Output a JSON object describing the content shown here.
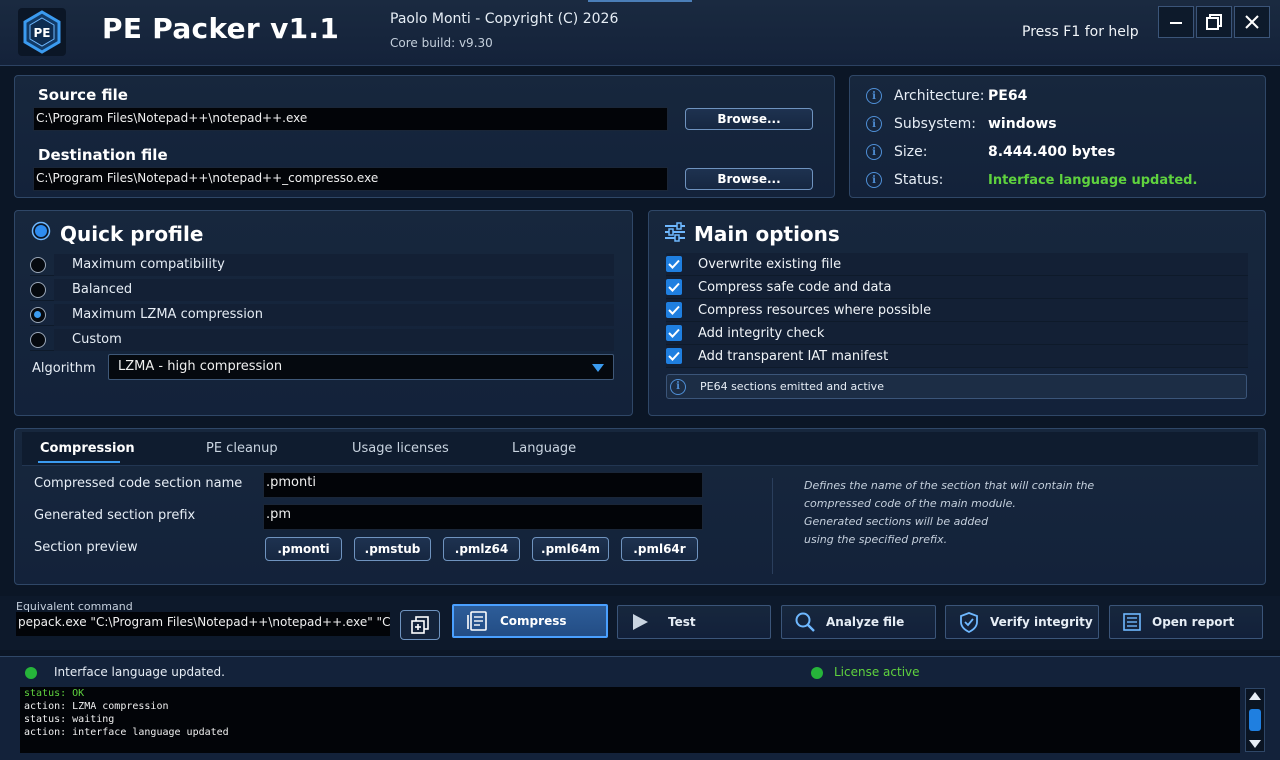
{
  "app": {
    "logo_text": "PE",
    "title": "PE Packer v1.1",
    "copyright": "Paolo Monti - Copyright (C) 2026",
    "core_build": "Core build: v9.30",
    "help": "Press F1 for help"
  },
  "files": {
    "source_label": "Source file",
    "source_path": "C:\\Program Files\\Notepad++\\notepad++.exe",
    "destination_label": "Destination file",
    "destination_path": "C:\\Program Files\\Notepad++\\notepad++_compresso.exe",
    "browse_label": "Browse..."
  },
  "info": [
    {
      "key": "Architecture:",
      "value": "PE64",
      "color": "#ffffff"
    },
    {
      "key": "Subsystem:",
      "value": "windows",
      "color": "#ffffff"
    },
    {
      "key": "Size:",
      "value": "8.444.400 bytes",
      "color": "#ffffff"
    },
    {
      "key": "Status:",
      "value": "Interface language updated.",
      "color": "#5fd23e"
    }
  ],
  "quick_profile": {
    "title": "Quick profile",
    "options": [
      {
        "label": "Maximum compatibility",
        "selected": false
      },
      {
        "label": "Balanced",
        "selected": false
      },
      {
        "label": "Maximum LZMA compression",
        "selected": true
      },
      {
        "label": "Custom",
        "selected": false
      }
    ],
    "algorithm_label": "Algorithm",
    "algorithm_value": "LZMA - high compression"
  },
  "main_options": {
    "title": "Main options",
    "items": [
      {
        "label": "Overwrite existing file",
        "checked": true
      },
      {
        "label": "Compress safe code and data",
        "checked": true
      },
      {
        "label": "Compress resources where possible",
        "checked": true
      },
      {
        "label": "Add integrity check",
        "checked": true
      },
      {
        "label": "Add transparent IAT manifest",
        "checked": true
      }
    ],
    "note": "PE64 sections emitted and active"
  },
  "tabs": [
    {
      "label": "Compression",
      "active": true
    },
    {
      "label": "PE cleanup",
      "active": false
    },
    {
      "label": "Usage licenses",
      "active": false
    },
    {
      "label": "Language",
      "active": false
    }
  ],
  "compression": {
    "section_name_label": "Compressed code section name",
    "section_name_value": ".pmonti",
    "prefix_label": "Generated section prefix",
    "prefix_value": ".pm",
    "preview_label": "Section preview",
    "preview_chips": [
      ".pmonti",
      ".pmstub",
      ".pmlz64",
      ".pml64m",
      ".pml64r"
    ],
    "hint_lines": [
      "Defines the name of the section that will contain the",
      "compressed code of the main module.",
      "Generated sections will be added",
      "using the specified prefix."
    ]
  },
  "command": {
    "label": "Equivalent command",
    "value": "pepack.exe \"C:\\Program Files\\Notepad++\\notepad++.exe\" \"C:\\Program Files\\Notepad++\\notepad++_compresso.exe\""
  },
  "actions": {
    "compress": "Compress",
    "test": "Test",
    "analyze": "Analyze file",
    "verify": "Verify integrity",
    "report": "Open report"
  },
  "statusbar": {
    "message": "Interface language updated.",
    "license": "License active"
  },
  "console_lines": [
    {
      "text": "status: OK",
      "color": "#5fd23e"
    },
    {
      "text": "action: LZMA compression",
      "color": "#f0f0f0"
    },
    {
      "text": "status: waiting",
      "color": "#f0f0f0"
    },
    {
      "text": "action: interface language updated",
      "color": "#f0f0f0"
    }
  ],
  "colors": {
    "accent": "#1f7fe0",
    "success": "#5fd23e",
    "background": "#0b1626"
  }
}
